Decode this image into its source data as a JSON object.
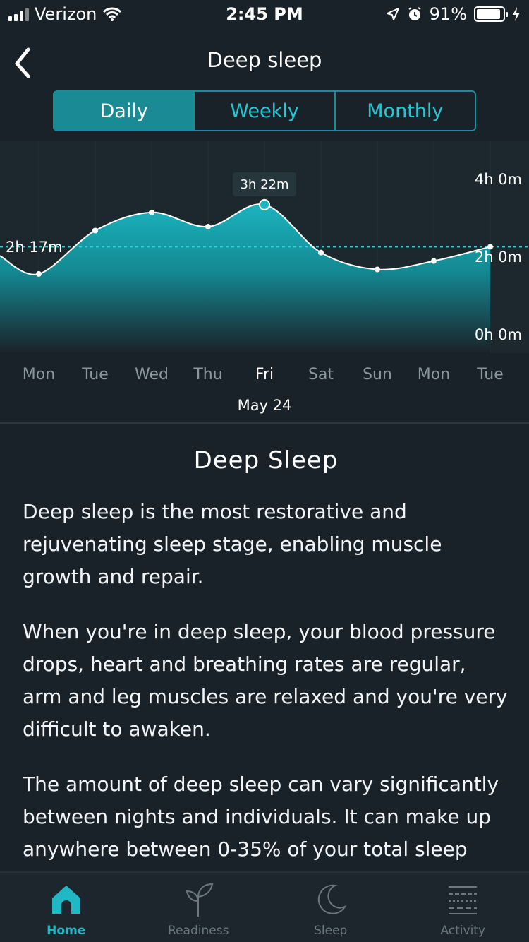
{
  "status_bar": {
    "carrier": "Verizon",
    "time": "2:45 PM",
    "battery_percent": "91%",
    "battery_level": 0.91
  },
  "header": {
    "title": "Deep sleep"
  },
  "segments": [
    {
      "label": "Daily",
      "active": true
    },
    {
      "label": "Weekly",
      "active": false
    },
    {
      "label": "Monthly",
      "active": false
    }
  ],
  "chart_data": {
    "type": "area",
    "categories": [
      "Mon",
      "Tue",
      "Wed",
      "Thu",
      "Fri",
      "Sat",
      "Sun",
      "Mon",
      "Tue"
    ],
    "values_minutes": [
      95,
      162,
      190,
      168,
      202,
      128,
      102,
      115,
      137
    ],
    "selected_index": 4,
    "selected_value": "3h 22m",
    "selected_date": "May 24",
    "average_label": "2h 17m",
    "average_minutes": 137,
    "ylim_minutes": [
      0,
      240
    ],
    "y_ticks": [
      "4h 0m",
      "2h 0m",
      "0h 0m"
    ]
  },
  "article": {
    "title": "Deep Sleep",
    "paragraphs": [
      "Deep sleep is the most restorative and rejuvenating sleep stage, enabling muscle growth and repair.",
      "When you're in deep sleep, your blood pressure drops, heart and breathing rates are regular, arm and leg muscles are relaxed and you're very difficult to awaken.",
      "The amount of deep sleep can vary significantly between nights and individuals. It can make up anywhere between 0-35% of your total sleep"
    ]
  },
  "tabs": [
    {
      "label": "Home",
      "icon": "home-icon",
      "active": true
    },
    {
      "label": "Readiness",
      "icon": "sprout-icon",
      "active": false
    },
    {
      "label": "Sleep",
      "icon": "moon-icon",
      "active": false
    },
    {
      "label": "Activity",
      "icon": "activity-icon",
      "active": false
    }
  ],
  "colors": {
    "accent": "#20b8c4",
    "background": "#1a2229"
  }
}
